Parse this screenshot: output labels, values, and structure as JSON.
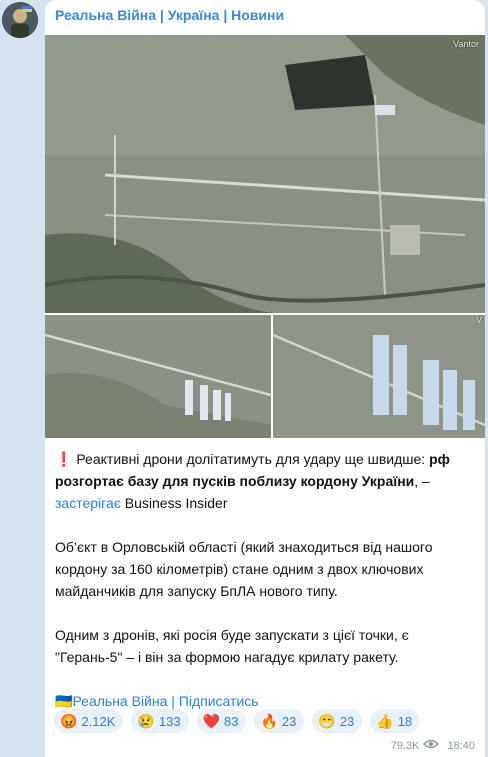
{
  "channel": {
    "name": "Реальна Війна | Україна | Новини"
  },
  "photos": [
    {
      "watermark": "Vantor"
    },
    {
      "watermark": "V"
    }
  ],
  "post": {
    "alert_icon": "❗",
    "line1_a": " Реактивні дрони долітатимуть для удару ще швидше: ",
    "line1_bold": "рф розгортає базу для пусків поблизу кордону України",
    "line1_b": ", – ",
    "source_link": "застерігає",
    "source_name": " Business Insider",
    "para2": "Об’єкт в Орловській області (який знаходиться від нашого кордону за 160 кілометрів) стане одним з двох ключових майданчиків для запуску БпЛА нового типу.",
    "para3": "Одним з дронів, які росія буде запускати з цієї точки, є \"Герань-5\" – і він за формою нагадує крилату ракету.",
    "footer_flag": "🇺🇦",
    "footer_link": "Реальна Війна | Підписатись"
  },
  "reactions": [
    {
      "emoji": "😡",
      "icon": "angry-face-icon",
      "count": "2.12K"
    },
    {
      "emoji": "😢",
      "icon": "crying-face-icon",
      "count": "133"
    },
    {
      "emoji": "❤️",
      "icon": "heart-icon",
      "count": "83"
    },
    {
      "emoji": "🔥",
      "icon": "fire-icon",
      "count": "23"
    },
    {
      "emoji": "😁",
      "icon": "grinning-face-icon",
      "count": "23"
    },
    {
      "emoji": "👍",
      "icon": "thumbs-up-icon",
      "count": "18"
    }
  ],
  "meta": {
    "views": "79.3K",
    "time": "18:40"
  },
  "colors": {
    "accent": "#3a8ad6",
    "bubble": "#ffffff",
    "background": "#d5e3f0"
  }
}
